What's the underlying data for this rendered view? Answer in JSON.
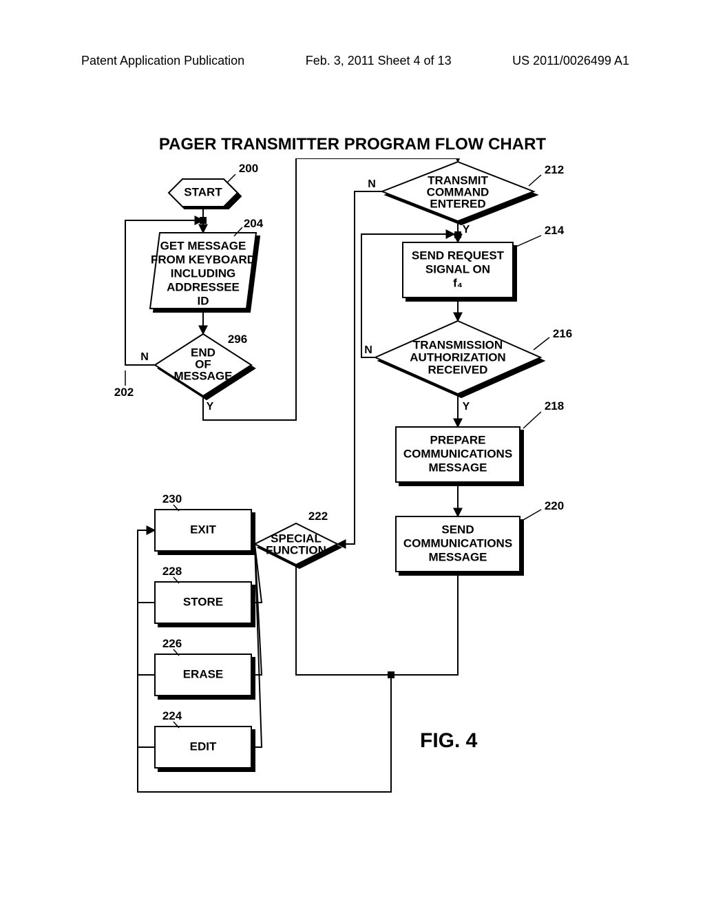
{
  "header": {
    "left": "Patent Application Publication",
    "center": "Feb. 3, 2011  Sheet 4 of 13",
    "right": "US 2011/0026499 A1"
  },
  "title": "PAGER TRANSMITTER PROGRAM FLOW CHART",
  "figure_label": "FIG. 4",
  "nodes": {
    "start": {
      "label": "START",
      "ref": "200"
    },
    "get_message": {
      "line1": "GET MESSAGE",
      "line2": "FROM KEYBOARD",
      "line3": "INCLUDING",
      "line4": "ADDRESSEE",
      "line5": "ID",
      "ref": "204"
    },
    "end_of_message": {
      "line1": "END",
      "line2": "OF",
      "line3": "MESSAGE",
      "ref": "296",
      "ref2": "202"
    },
    "transmit_cmd": {
      "line1": "TRANSMIT",
      "line2": "COMMAND",
      "line3": "ENTERED",
      "ref": "212"
    },
    "send_request": {
      "line1": "SEND REQUEST",
      "line2": "SIGNAL ON",
      "line3": "f₄",
      "ref": "214"
    },
    "auth_received": {
      "line1": "TRANSMISSION",
      "line2": "AUTHORIZATION",
      "line3": "RECEIVED",
      "ref": "216"
    },
    "prepare_msg": {
      "line1": "PREPARE",
      "line2": "COMMUNICATIONS",
      "line3": "MESSAGE",
      "ref": "218"
    },
    "send_msg": {
      "line1": "SEND",
      "line2": "COMMUNICATIONS",
      "line3": "MESSAGE",
      "ref": "220"
    },
    "special_fn": {
      "line1": "SPECIAL",
      "line2": "FUNCTION",
      "ref": "222"
    },
    "exit": {
      "label": "EXIT",
      "ref": "230"
    },
    "store": {
      "label": "STORE",
      "ref": "228"
    },
    "erase": {
      "label": "ERASE",
      "ref": "226"
    },
    "edit": {
      "label": "EDIT",
      "ref": "224"
    }
  },
  "edges": {
    "n": "N",
    "y": "Y"
  }
}
